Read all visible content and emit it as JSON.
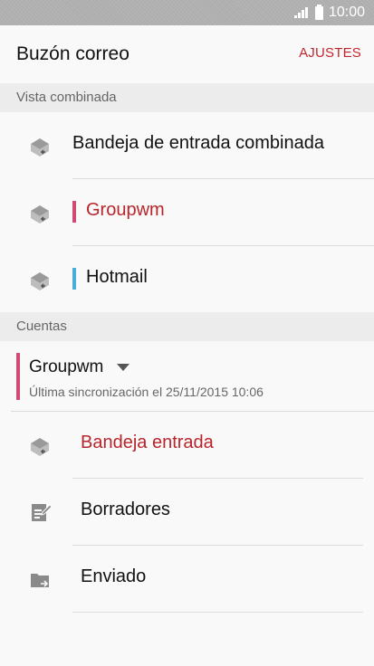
{
  "status_bar": {
    "time": "10:00",
    "signal_icon": "signal-icon",
    "battery_icon": "battery-icon"
  },
  "header": {
    "title": "Buzón correo",
    "settings_label": "AJUSTES"
  },
  "combined_view": {
    "header": "Vista combinada",
    "items": [
      {
        "label": "Bandeja de entrada combinada",
        "icon": "inbox-icon",
        "accent": null
      },
      {
        "label": "Groupwm",
        "icon": "inbox-icon",
        "accent": "#d04a74"
      },
      {
        "label": "Hotmail",
        "icon": "inbox-icon",
        "accent": "#4aafd8"
      }
    ]
  },
  "accounts": {
    "header": "Cuentas",
    "account": {
      "name": "Groupwm",
      "sync_text": "Última sincronización el 25/11/2015 10:06",
      "accent": "#d04a74"
    },
    "folders": [
      {
        "label": "Bandeja entrada",
        "icon": "inbox-icon"
      },
      {
        "label": "Borradores",
        "icon": "drafts-icon"
      },
      {
        "label": "Enviado",
        "icon": "sent-folder-icon"
      }
    ]
  },
  "colors": {
    "accent_red": "#c0272d",
    "header_bg": "#ececec",
    "status_bar_bg": "#aeaeae"
  }
}
